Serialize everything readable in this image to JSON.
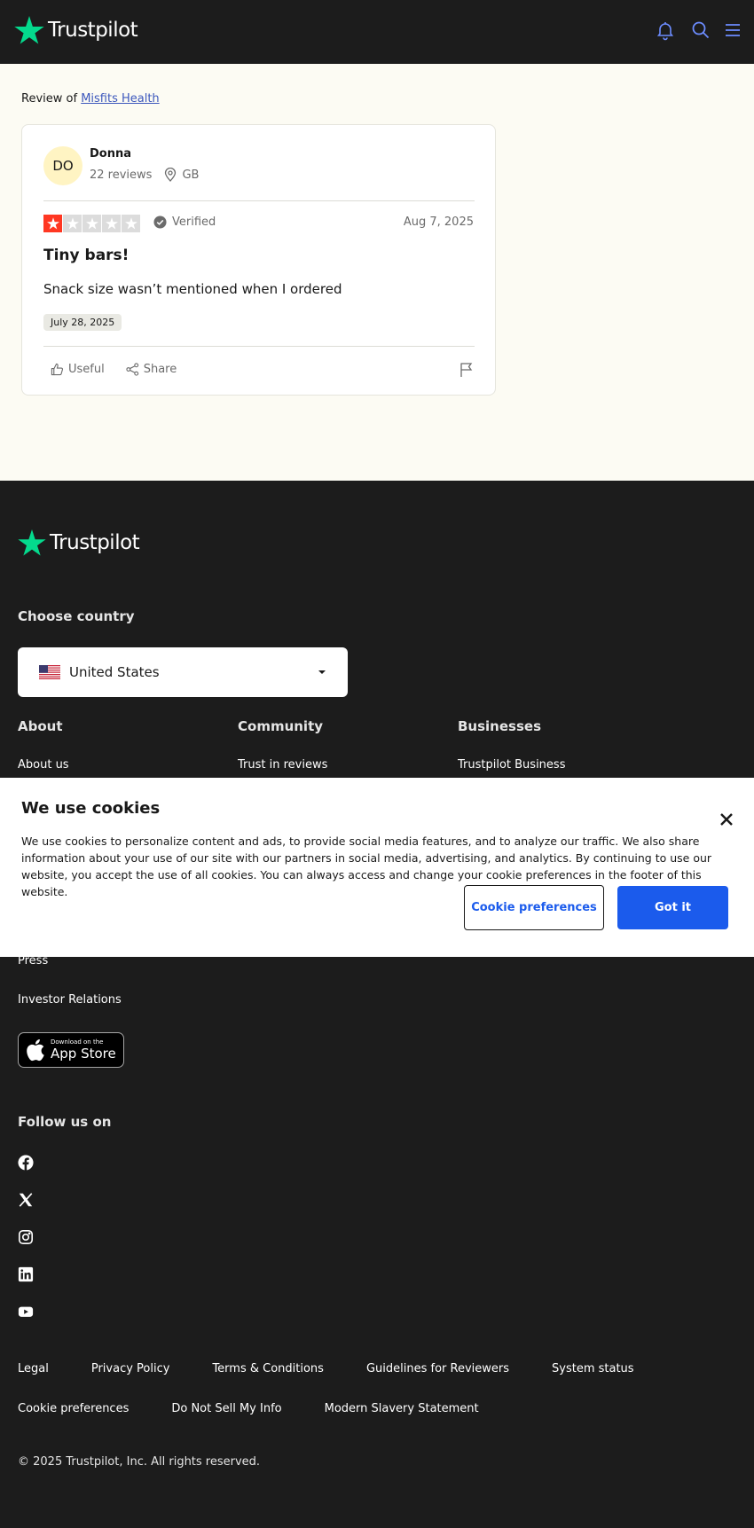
{
  "header": {
    "brand": "Trustpilot",
    "icons": [
      "bell-icon",
      "search-icon",
      "menu-icon"
    ]
  },
  "review_page": {
    "review_of_label": "Review of",
    "company_name": "Misfits Health"
  },
  "review": {
    "avatar_initials": "DO",
    "author_name": "Donna",
    "review_count": "22 reviews",
    "location": "GB",
    "rating": 1,
    "rating_max": 5,
    "verified_label": "Verified",
    "date": "Aug 7, 2025",
    "title": "Tiny bars!",
    "body": "Snack size wasn’t mentioned when I ordered",
    "experience_date": "July 28, 2025",
    "useful_label": "Useful",
    "share_label": "Share"
  },
  "footer": {
    "brand": "Trustpilot",
    "choose_country_label": "Choose country",
    "selected_country": "United States",
    "columns": [
      {
        "heading": "About",
        "first_link": "About us"
      },
      {
        "heading": "Community",
        "first_link": "Trust in reviews"
      },
      {
        "heading": "Businesses",
        "first_link": "Trustpilot Business"
      }
    ],
    "press": "Press",
    "investor_relations": "Investor Relations",
    "app_store_small": "Download on the",
    "app_store_big": "App Store",
    "follow_label": "Follow us on",
    "social": [
      "facebook-icon",
      "x-icon",
      "instagram-icon",
      "linkedin-icon",
      "youtube-icon"
    ],
    "legal_row_1": [
      "Legal",
      "Privacy Policy",
      "Terms & Conditions",
      "Guidelines for Reviewers",
      "System status"
    ],
    "legal_row_2": [
      "Cookie preferences",
      "Do Not Sell My Info",
      "Modern Slavery Statement"
    ],
    "copyright": "© 2025 Trustpilot, Inc. All rights reserved."
  },
  "cookie_banner": {
    "title": "We use cookies",
    "text": "We use cookies to personalize content and ads, to provide social media features, and to analyze our traffic. We also share information about your use of our site with our partners in social media, advertising, and analytics. By continuing to use our website, you accept the use of all cookies. You can always access and change your cookie preferences in the footer of this website.",
    "preferences_button": "Cookie preferences",
    "accept_button": "Got it"
  },
  "colors": {
    "brand_green": "#04da8d",
    "star_red": "#ff3722",
    "link_blue": "#3c57bc",
    "button_blue": "#1b5bec",
    "dark_bg": "#1c1c1c",
    "page_bg": "#fcfbf3"
  }
}
